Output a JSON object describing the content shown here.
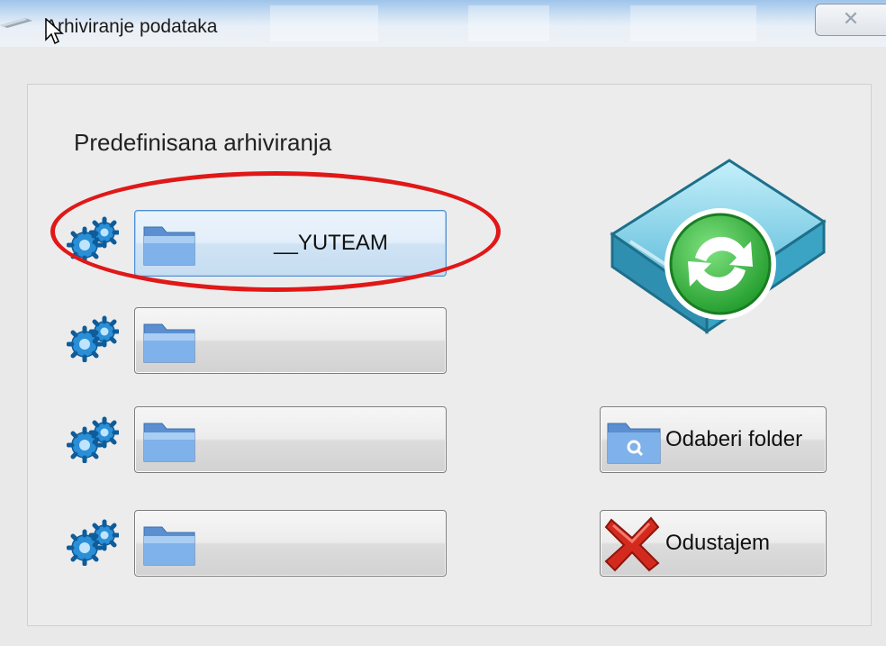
{
  "window": {
    "title": "Arhiviranje podataka",
    "close_label": "✕"
  },
  "section": {
    "label": "Predefinisana arhiviranja"
  },
  "archive_slots": [
    {
      "label": "__YUTEAM",
      "focused": true
    },
    {
      "label": "",
      "focused": false
    },
    {
      "label": "",
      "focused": false
    },
    {
      "label": "",
      "focused": false
    }
  ],
  "actions": {
    "choose_folder_label": "Odaberi folder",
    "cancel_label": "Odustajem"
  },
  "colors": {
    "accent_blue": "#4f8fd1",
    "annotation_red": "#e01818",
    "sync_green": "#3cb83c"
  },
  "icons": {
    "gear": "gears-icon",
    "folder": "folder-icon",
    "sync": "archive-sync-icon",
    "search_folder": "folder-search-icon",
    "cancel": "red-x-icon"
  }
}
